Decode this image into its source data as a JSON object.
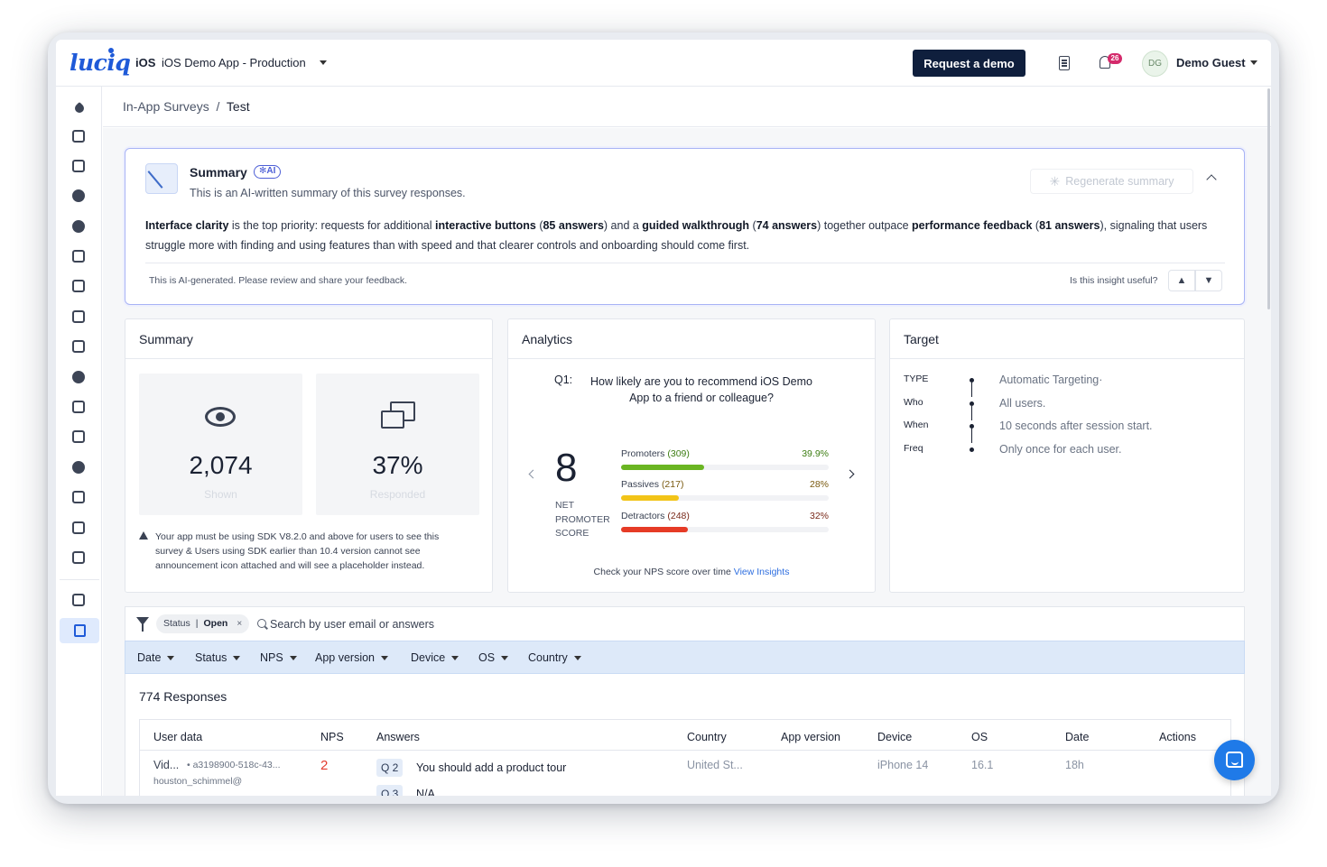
{
  "header": {
    "logo": "luciq",
    "platform": "iOS",
    "app_name": "iOS Demo App - Production",
    "demo_button": "Request a demo",
    "notification_count": "26",
    "user_initials": "DG",
    "user_name": "Demo Guest"
  },
  "breadcrumb": {
    "parent": "In-App Surveys",
    "separator": "/",
    "current": "Test"
  },
  "ai_summary": {
    "title": "Summary",
    "badge": "AI",
    "subtitle": "This is an AI-written summary of this survey responses.",
    "regenerate_label": "Regenerate summary",
    "text_parts": [
      {
        "bold": true,
        "text": "Interface clarity"
      },
      {
        "bold": false,
        "text": " is the top priority: requests for additional "
      },
      {
        "bold": true,
        "text": "interactive buttons"
      },
      {
        "bold": false,
        "text": " ("
      },
      {
        "bold": true,
        "text": "85 answers"
      },
      {
        "bold": false,
        "text": ") and a "
      },
      {
        "bold": true,
        "text": "guided walkthrough"
      },
      {
        "bold": false,
        "text": " ("
      },
      {
        "bold": true,
        "text": "74 answers"
      },
      {
        "bold": false,
        "text": ") together outpace "
      },
      {
        "bold": true,
        "text": "performance feedback"
      },
      {
        "bold": false,
        "text": " ("
      },
      {
        "bold": true,
        "text": "81 answers"
      },
      {
        "bold": false,
        "text": "), signaling that users struggle more with finding and using features than with speed and that clearer controls and onboarding should come first."
      }
    ],
    "disclaimer": "This is AI-generated. Please review and share your feedback.",
    "useful_question": "Is this insight useful?"
  },
  "summary_panel": {
    "title": "Summary",
    "shown_value": "2,074",
    "shown_label": "Shown",
    "responded_value": "37%",
    "responded_label": "Responded",
    "warning": "Your app must be using SDK V8.2.0 and above for users to see this survey & Users using SDK earlier than 10.4 version cannot see announcement icon attached and will see a placeholder instead."
  },
  "analytics_panel": {
    "title": "Analytics",
    "question_label": "Q1:",
    "question_text": "How likely are you to recommend iOS Demo App to a friend or colleague?",
    "nps_score": "8",
    "nps_caption_1": "NET",
    "nps_caption_2": "PROMOTER",
    "nps_caption_3": "SCORE",
    "bars": [
      {
        "name": "Promoters",
        "count": "(309)",
        "percent_label": "39.9%",
        "fraction": 0.399,
        "color": "#6ab522",
        "text_color": "#3c7d12"
      },
      {
        "name": "Passives",
        "count": "(217)",
        "percent_label": "28%",
        "fraction": 0.28,
        "color": "#f2c418",
        "text_color": "#7a5a10"
      },
      {
        "name": "Detractors",
        "count": "(248)",
        "percent_label": "32%",
        "fraction": 0.32,
        "color": "#e63b26",
        "text_color": "#7a2a1a"
      }
    ],
    "footer_text": "Check your NPS score over time",
    "footer_link": "View Insights"
  },
  "target_panel": {
    "title": "Target",
    "rows": [
      {
        "key": "TYPE",
        "value": "Automatic Targeting·"
      },
      {
        "key": "Who",
        "value": "All users."
      },
      {
        "key": "When",
        "value": "10 seconds after session start."
      },
      {
        "key": "Freq",
        "value": "Only once for each user."
      }
    ]
  },
  "filters": {
    "chip_key": "Status",
    "chip_sep": "|",
    "chip_value": "Open",
    "chip_remove": "×",
    "search_placeholder": "Search by user email or answers",
    "dropdowns": [
      "Date",
      "Status",
      "NPS",
      "App version",
      "Device",
      "OS",
      "Country"
    ]
  },
  "responses": {
    "count_label": "774 Responses",
    "columns": [
      "User data",
      "NPS",
      "Answers",
      "Country",
      "App version",
      "Device",
      "OS",
      "Date",
      "Actions"
    ],
    "row": {
      "user_short": "Vid...",
      "user_id": "• a3198900-518c-43...",
      "user_email": "houston_schimmel@",
      "nps": "2",
      "q2_label": "Q 2",
      "q2_answer": "You should add a product tour",
      "q3_label": "Q 3",
      "q3_answer": "N/A",
      "country": "United St...",
      "device": "iPhone 14",
      "os": "16.1",
      "date": "18h"
    }
  }
}
